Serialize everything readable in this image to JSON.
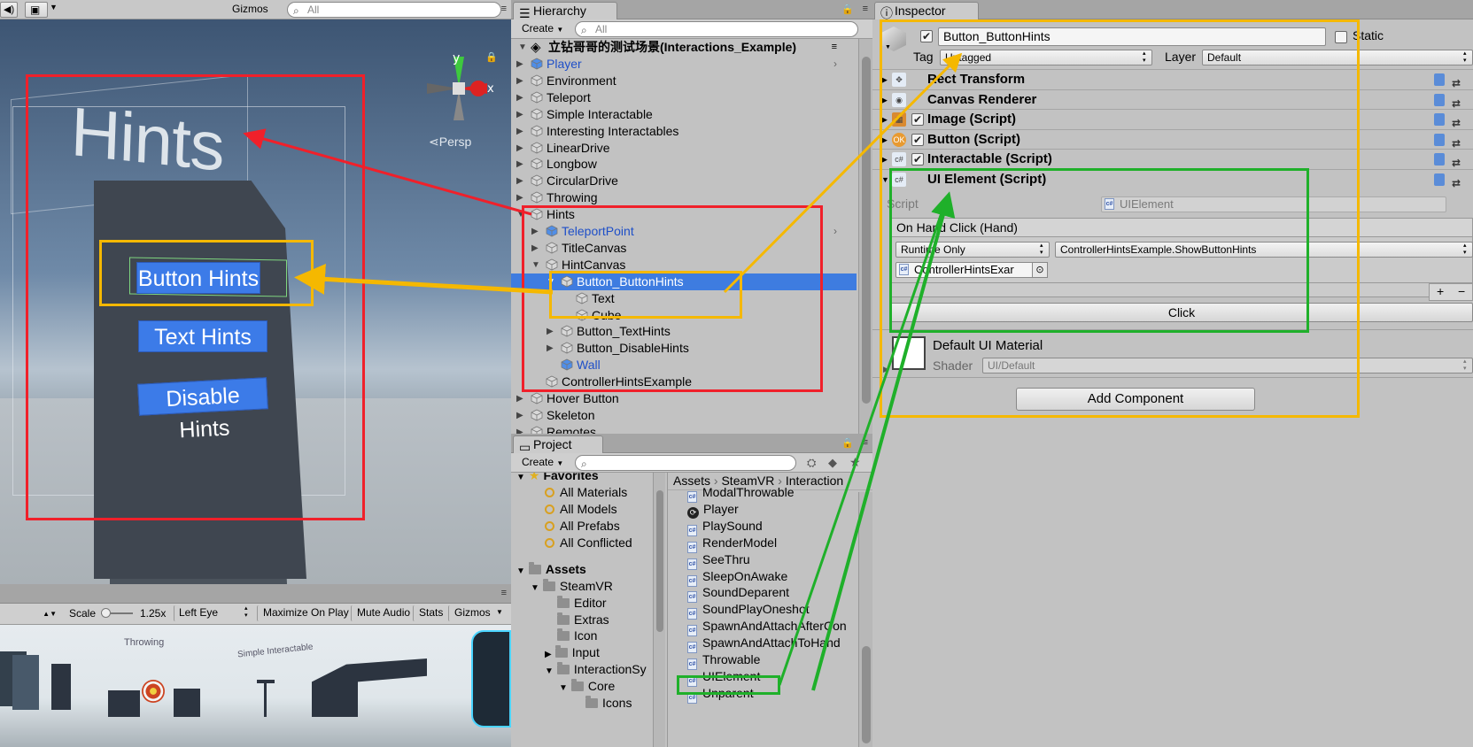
{
  "scene": {
    "gizmos_label": "Gizmos",
    "search_placeholder": "All",
    "persp_label": "Persp",
    "axis_y": "y",
    "axis_x": "x",
    "hint_title": "Hints",
    "buttons": [
      "Button Hints",
      "Text Hints",
      "Disable Hints"
    ]
  },
  "game": {
    "scale_label": "Scale",
    "scale_value": "1.25x",
    "eye": "Left Eye",
    "toggles": [
      "Maximize On Play",
      "Mute Audio",
      "Stats",
      "Gizmos"
    ],
    "world_labels": [
      "Throwing",
      "Simple Interactable"
    ]
  },
  "hierarchy": {
    "tab": "Hierarchy",
    "create": "Create",
    "search_placeholder": "All",
    "scene_name": "立钻哥哥的测试场景(Interactions_Example)",
    "items": [
      {
        "label": "Player",
        "blue": true
      },
      {
        "label": "Environment"
      },
      {
        "label": "Teleport"
      },
      {
        "label": "Simple Interactable"
      },
      {
        "label": "Interesting Interactables"
      },
      {
        "label": "LinearDrive"
      },
      {
        "label": "Longbow"
      },
      {
        "label": "CircularDrive"
      },
      {
        "label": "Throwing"
      },
      {
        "label": "Hints"
      },
      {
        "label": "TeleportPoint",
        "blue": true
      },
      {
        "label": "TitleCanvas"
      },
      {
        "label": "HintCanvas"
      },
      {
        "label": "Button_ButtonHints"
      },
      {
        "label": "Text"
      },
      {
        "label": "Cube"
      },
      {
        "label": "Button_TextHints"
      },
      {
        "label": "Button_DisableHints"
      },
      {
        "label": "Wall",
        "blue": true
      },
      {
        "label": "ControllerHintsExample"
      },
      {
        "label": "Hover Button"
      },
      {
        "label": "Skeleton"
      },
      {
        "label": "Remotes"
      }
    ]
  },
  "project": {
    "tab": "Project",
    "create": "Create",
    "favorites_label": "Favorites",
    "favorites": [
      "All Materials",
      "All Models",
      "All Prefabs",
      "All Conflicted"
    ],
    "assets_label": "Assets",
    "folders": [
      "SteamVR",
      "Editor",
      "Extras",
      "Icon",
      "Input",
      "InteractionSy",
      "Core",
      "Icons"
    ],
    "breadcrumb": [
      "Assets",
      "SteamVR",
      "Interaction"
    ],
    "files": [
      "ModalThrowable",
      "Player",
      "PlaySound",
      "RenderModel",
      "SeeThru",
      "SleepOnAwake",
      "SoundDeparent",
      "SoundPlayOneshot",
      "SpawnAndAttachAfterCon",
      "SpawnAndAttachToHand",
      "Throwable",
      "UIElement",
      "Unparent"
    ]
  },
  "inspector": {
    "tab": "Inspector",
    "object_name": "Button_ButtonHints",
    "static_label": "Static",
    "tag_label": "Tag",
    "tag_value": "Untagged",
    "layer_label": "Layer",
    "layer_value": "Default",
    "components": [
      "Rect Transform",
      "Canvas Renderer",
      "Image (Script)",
      "Button (Script)",
      "Interactable (Script)",
      "UI Element (Script)"
    ],
    "script_label": "Script",
    "script_value": "UIElement",
    "event_label": "On Hand Click (Hand)",
    "runtime_value": "Runtime Only",
    "function_value": "ControllerHintsExample.ShowButtonHints",
    "object_ref": "ControllerHintsExar",
    "plus": "+",
    "minus": "−",
    "click_label": "Click",
    "material_name": "Default UI Material",
    "shader_label": "Shader",
    "shader_value": "UI/Default",
    "add_component": "Add Component"
  },
  "colors": {
    "annotation_red": "#f0202a",
    "annotation_yellow": "#f5b800",
    "annotation_green": "#1fb02a",
    "selection_blue": "#3e7ce0"
  }
}
